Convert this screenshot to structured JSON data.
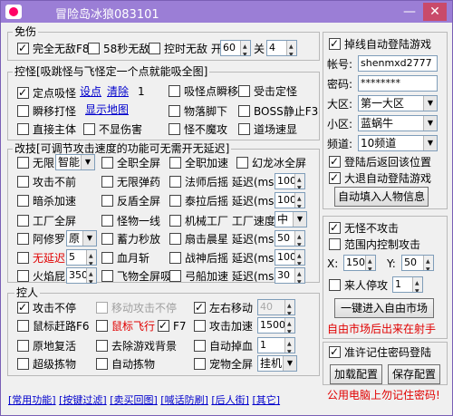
{
  "title": "冒险岛冰狼083101",
  "window": {
    "minimize": "—",
    "close": "✕"
  },
  "colors": {
    "titlebar": "#9b7ed6",
    "red_text": "#e00000",
    "link": "#0000cc"
  },
  "mianshang": {
    "title": "免伤",
    "full_nodmg": "完全无敌F8",
    "full_nodmg_checked": true,
    "nodmg58": "58秒无敌",
    "nodmg58_checked": false,
    "timed_nodmg": "控时无敌 开",
    "timed_on_val": "60",
    "timed_off_label": "关",
    "timed_off_val": "4"
  },
  "guai": {
    "title": "控怪[吸跳怪与飞怪定一个点就能吸全图]",
    "fixed_suck": "定点吸怪",
    "set_point": "设点",
    "clear": "清除",
    "count": "1",
    "suck_teleport": "吸怪点瞬移",
    "freeze": "受击定怪",
    "teleport_hit": "瞬移打怪",
    "show_coords": "显示地图",
    "item_under_foot": "物落脚下",
    "boss_stop": "BOSS静止F3",
    "attack_direct": "直接主体",
    "no_dmg_show": "不显伤害",
    "no_knockback": "怪不魔攻",
    "dungeon_speed": "道场速显"
  },
  "gaiji": {
    "title": "改技[可调节攻击速度的功能可无需开无延迟]",
    "no_cd": "无限",
    "no_cd_sel": "智能",
    "full_screen_atk": "全职全屏",
    "full_screen_spd": "全职加速",
    "phantom_full": "幻龙冰全屏",
    "atk_no_stop": "攻击不前",
    "no_ammo": "无限弹药",
    "mage_delay": "法师后摇 延迟(ms):",
    "mage_delay_val": "100",
    "dark_speed": "暗杀加速",
    "reverse_full": "反盾全屏",
    "aran_delay": "泰拉后摇 延迟(ms):",
    "aran_delay_val": "100",
    "worker_full": "工厂全屏",
    "monster_line": "怪物一线",
    "factory_speed": "机械工厂 工厂速度:",
    "factory_speed_val": "中",
    "asura": "阿修罗",
    "asura_sel": "原",
    "storm_instant": "蓄力秒放",
    "fan_delay": "扇击晨星 延迟(ms):",
    "fan_delay_val": "50",
    "no_delay": "无延迟",
    "no_delay_val": "5",
    "blood_cut": "血月斩",
    "warrior_delay": "战神后摇 延迟(ms):",
    "warrior_delay_val": "100",
    "fire_bomb": "火焰屁",
    "fire_bomb_val": "350",
    "flying_full": "飞物全屏吸",
    "bow_speed": "弓船加速 延迟(ms):",
    "bow_speed_val": "30"
  },
  "kongren": {
    "title": "控人",
    "attack_nonstop": "攻击不停",
    "attack_nonstop_checked": true,
    "move_attack": "移动攻击不停",
    "lr_move": "左右移动",
    "lr_move_checked": true,
    "lr_move_val": "40",
    "mouse_dash": "鼠标赶路F6",
    "mouse_fly": "鼠标飞行",
    "f7_label": "F7",
    "f7_checked": true,
    "attack_speed": "攻击加速",
    "attack_speed_val": "1500",
    "revive": "原地复活",
    "remove_bg": "去除游戏背景",
    "auto_hp": "自动掉血",
    "auto_hp_val": "1",
    "super_loot": "超级拣物",
    "auto_loot": "自动拣物",
    "pet_full": "宠物全屏",
    "pet_full_sel": "挂机"
  },
  "login": {
    "disconnect_relogin": "掉线自动登陆游戏",
    "disconnect_checked": true,
    "account_label": "帐号:",
    "account_val": "shenmxd2777",
    "password_label": "密码:",
    "password_val": "********",
    "region_label": "大区:",
    "region_val": "第一大区",
    "server_label": "小区:",
    "server_val": "蓝蜗牛",
    "channel_label": "频道:",
    "channel_val": "10频道",
    "return_pos": "登陆后返回该位置",
    "return_pos_checked": true,
    "big_retreat": "大退自动登陆游戏",
    "big_retreat_checked": true,
    "fill_info": "自动填入人物信息"
  },
  "market": {
    "no_monster_attack": "无怪不攻击",
    "no_monster_checked": true,
    "range_attack": "范围内控制攻击",
    "x_label": "X:",
    "x_val": "150",
    "y_label": "Y:",
    "y_val": "50",
    "auto_stop": "来人停攻",
    "auto_stop_val": "1",
    "enter_market": "一键进入自由市场",
    "warning": "自由市场后出来在射手"
  },
  "save": {
    "remember_pw": "准许记住密码登陆",
    "remember_checked": true,
    "load_config": "加载配置",
    "save_config": "保存配置",
    "warning": "公用电脑上勿记住密码!"
  },
  "links": [
    "[常用功能]",
    "[按键过滤]",
    "[卖买回图]",
    "[喊话防刷]",
    "[后人街]",
    "[其它]"
  ]
}
